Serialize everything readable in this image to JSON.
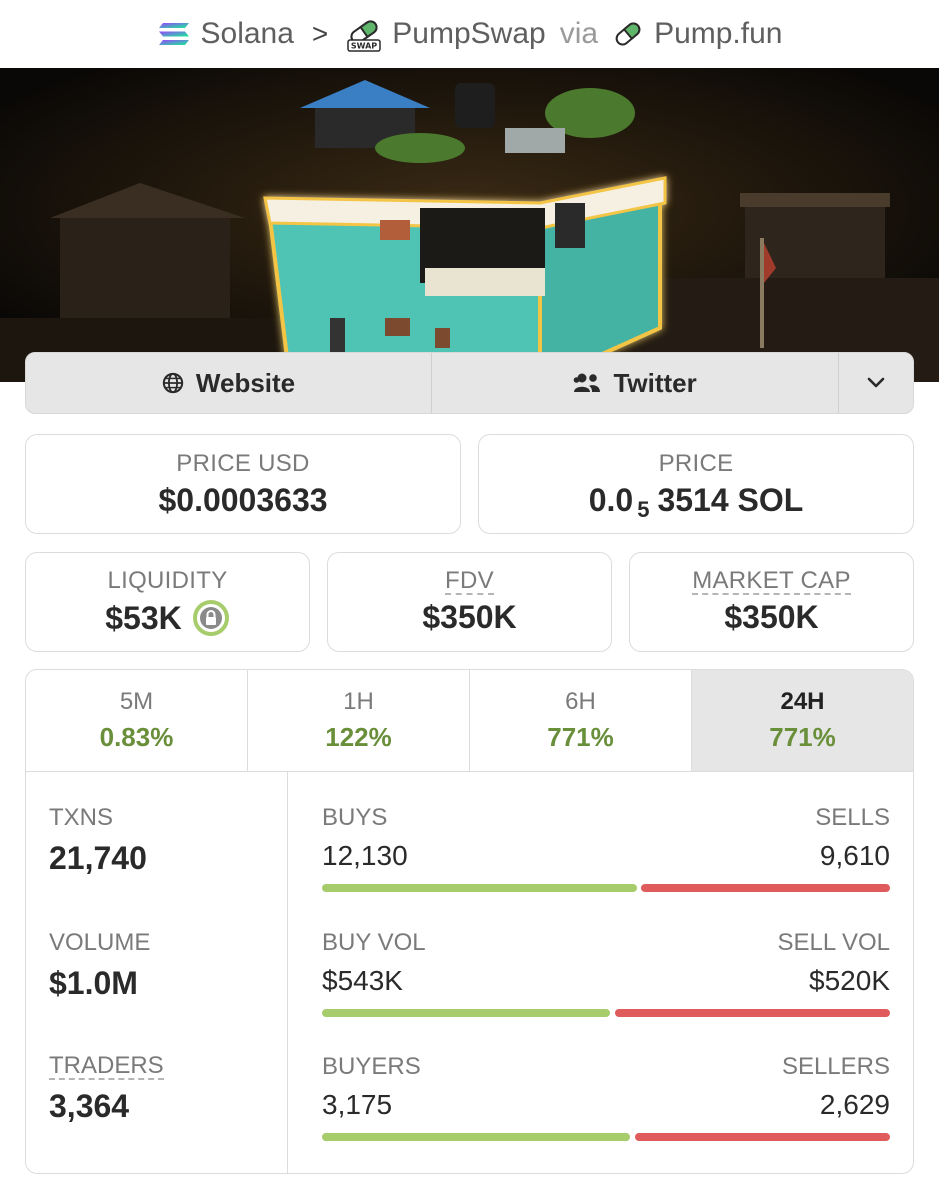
{
  "breadcrumb": {
    "chain": "Solana",
    "separator": ">",
    "dex": "PumpSwap",
    "via": "via",
    "launchpad": "Pump.fun",
    "dex_badge": "SWAP"
  },
  "links": {
    "website": "Website",
    "twitter": "Twitter"
  },
  "price_usd": {
    "label": "PRICE USD",
    "value": "$0.0003633"
  },
  "price_native": {
    "label": "PRICE",
    "prefix": "0.0",
    "subscript": "5",
    "rest": "3514 SOL"
  },
  "liquidity": {
    "label": "LIQUIDITY",
    "value": "$53K"
  },
  "fdv": {
    "label": "FDV",
    "value": "$350K"
  },
  "market_cap": {
    "label": "MARKET CAP",
    "value": "$350K"
  },
  "timeframes": [
    {
      "label": "5M",
      "change": "0.83%"
    },
    {
      "label": "1H",
      "change": "122%"
    },
    {
      "label": "6H",
      "change": "771%"
    },
    {
      "label": "24H",
      "change": "771%",
      "active": true
    }
  ],
  "stats": {
    "txns": {
      "label": "TXNS",
      "value": "21,740"
    },
    "volume": {
      "label": "VOLUME",
      "value": "$1.0M"
    },
    "traders": {
      "label": "TRADERS",
      "value": "3,364"
    }
  },
  "ratios": {
    "txns": {
      "left_label": "BUYS",
      "right_label": "SELLS",
      "left_value": "12,130",
      "right_value": "9,610",
      "buy_fraction": 0.558
    },
    "volume": {
      "left_label": "BUY VOL",
      "right_label": "SELL VOL",
      "left_value": "$543K",
      "right_value": "$520K",
      "buy_fraction": 0.511
    },
    "traders": {
      "left_label": "BUYERS",
      "right_label": "SELLERS",
      "left_value": "3,175",
      "right_value": "2,629",
      "buy_fraction": 0.547
    }
  },
  "colors": {
    "positive": "#6a8f3a",
    "buy_bar": "#a6cc6b",
    "sell_bar": "#e05b5b",
    "lock_ring": "#a6cc6b"
  }
}
